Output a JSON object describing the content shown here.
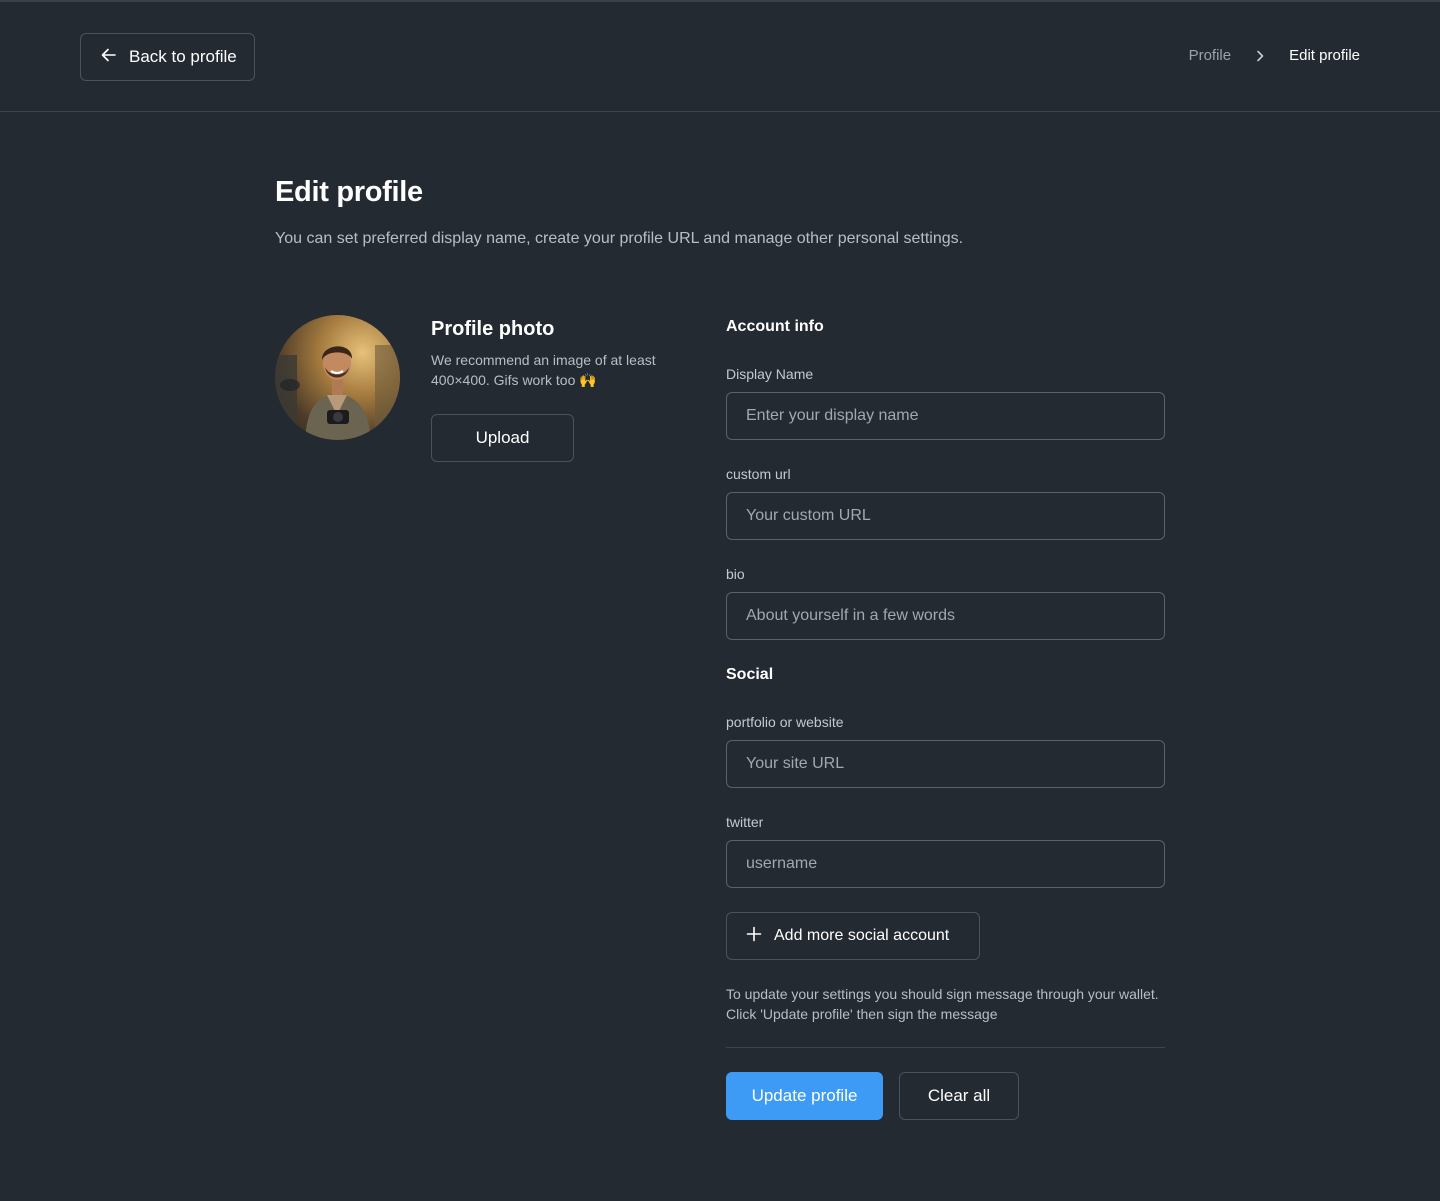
{
  "header": {
    "back_label": "Back to profile",
    "breadcrumb": {
      "parent": "Profile",
      "current": "Edit profile"
    }
  },
  "page": {
    "title": "Edit profile",
    "subtitle": "You can set preferred display name, create your profile URL and manage other personal settings."
  },
  "photo": {
    "title": "Profile photo",
    "description": "We recommend an image of at least 400×400. Gifs work too 🙌",
    "upload_label": "Upload"
  },
  "account": {
    "section_title": "Account info",
    "display_name": {
      "label": "Display Name",
      "placeholder": "Enter your display name",
      "value": ""
    },
    "custom_url": {
      "label": "custom url",
      "placeholder": "Your custom URL",
      "value": ""
    },
    "bio": {
      "label": "bio",
      "placeholder": "About yourself in a few words",
      "value": ""
    }
  },
  "social": {
    "section_title": "Social",
    "website": {
      "label": "portfolio or website",
      "placeholder": "Your site URL",
      "value": ""
    },
    "twitter": {
      "label": "twitter",
      "placeholder": "username",
      "value": ""
    },
    "add_more_label": "Add more social account"
  },
  "footer": {
    "note": "To update your settings you should sign message through your wallet. Click 'Update profile' then sign the message",
    "update_label": "Update profile",
    "clear_label": "Clear all"
  },
  "colors": {
    "background": "#242a31",
    "accent": "#3e9bf5",
    "border": "#4a525b"
  }
}
